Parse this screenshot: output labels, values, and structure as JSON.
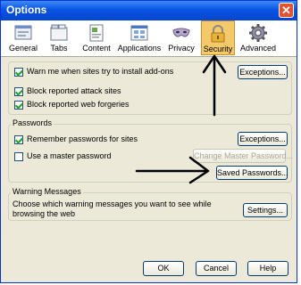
{
  "window": {
    "title": "Options",
    "close_symbol": "✕"
  },
  "toolbar": {
    "items": [
      {
        "label": "General",
        "icon": "general-icon"
      },
      {
        "label": "Tabs",
        "icon": "tabs-icon"
      },
      {
        "label": "Content",
        "icon": "content-icon"
      },
      {
        "label": "Applications",
        "icon": "applications-icon"
      },
      {
        "label": "Privacy",
        "icon": "privacy-mask-icon"
      },
      {
        "label": "Security",
        "icon": "padlock-icon",
        "selected": true
      },
      {
        "label": "Advanced",
        "icon": "gear-icon"
      }
    ]
  },
  "addons": {
    "warn_label": "Warn me when sites try to install add-ons",
    "warn_checked": true,
    "exceptions_label": "Exceptions...",
    "block_attack_label": "Block reported attack sites",
    "block_attack_checked": true,
    "block_forgeries_label": "Block reported web forgeries",
    "block_forgeries_checked": true
  },
  "passwords": {
    "legend": "Passwords",
    "remember_label": "Remember passwords for sites",
    "remember_checked": true,
    "exceptions_label": "Exceptions...",
    "master_label": "Use a master password",
    "master_checked": false,
    "change_master_label": "Change Master Password...",
    "saved_passwords_label": "Saved Passwords..."
  },
  "warnings": {
    "legend": "Warning Messages",
    "description": "Choose which warning messages you want to see while browsing the web",
    "settings_label": "Settings..."
  },
  "footer": {
    "ok_label": "OK",
    "cancel_label": "Cancel",
    "help_label": "Help"
  },
  "colors": {
    "titlebar": "#0a54e3",
    "selected_tab": "#f4c96a",
    "dialog_bg": "#ece9d8",
    "check": "#21a121"
  }
}
